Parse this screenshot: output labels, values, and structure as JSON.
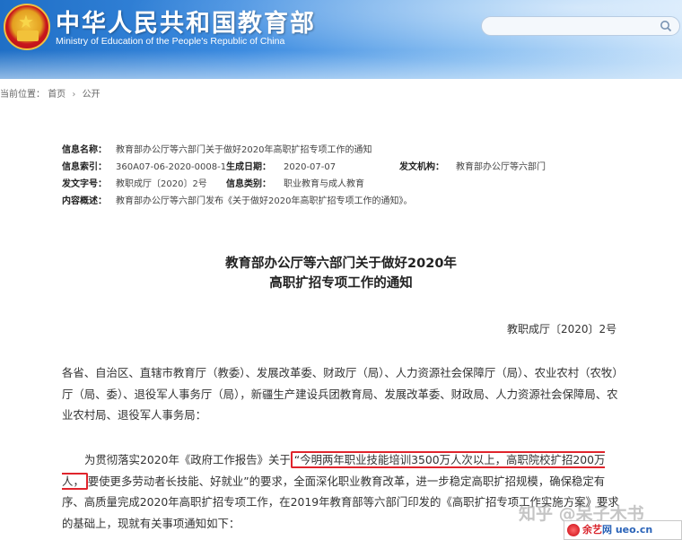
{
  "header": {
    "title": "中华人民共和国教育部",
    "subtitle": "Ministry of Education of the People's Republic of China",
    "search_placeholder": ""
  },
  "breadcrumb": {
    "prefix": "当前位置：",
    "items": [
      "首页",
      "公开"
    ],
    "separator": "›"
  },
  "info": {
    "rows": [
      [
        {
          "label": "信息名称：",
          "value": "教育部办公厅等六部门关于做好2020年高职扩招专项工作的通知"
        }
      ],
      [
        {
          "label": "信息索引：",
          "value": "360A07-06-2020-0008-1"
        },
        {
          "label": "生成日期：",
          "value": "2020-07-07"
        },
        {
          "label": "发文机构：",
          "value": "教育部办公厅等六部门"
        }
      ],
      [
        {
          "label": "发文字号：",
          "value": "教职成厅〔2020〕2号"
        },
        {
          "label": "信息类别：",
          "value": "职业教育与成人教育"
        }
      ],
      [
        {
          "label": "内容概述：",
          "value": "教育部办公厅等六部门发布《关于做好2020年高职扩招专项工作的通知》。"
        }
      ]
    ]
  },
  "document": {
    "title_line1": "教育部办公厅等六部门关于做好2020年",
    "title_line2": "高职扩招专项工作的通知",
    "number": "教职成厅〔2020〕2号",
    "paragraph1": "各省、自治区、直辖市教育厅（教委）、发展改革委、财政厅（局）、人力资源社会保障厅（局）、农业农村（农牧）厅（局、委）、退役军人事务厅（局），新疆生产建设兵团教育局、发展改革委、财政局、人力资源社会保障局、农业农村局、退役军人事务局：",
    "paragraph2_before": "为贯彻落实2020年《政府工作报告》关于",
    "paragraph2_highlight": "“今明两年职业技能培训3500万人次以上，高职院校扩招200万人，",
    "paragraph2_after": "要使更多劳动者长技能、好就业”的要求，全面深化职业教育改革，进一步稳定高职扩招规模，确保稳定有序、高质量完成2020年高职扩招专项工作，在2019年教育部等六部门印发的《高职扩招专项工作实施方案》要求的基础上，现就有关事项通知如下："
  },
  "watermark": {
    "text": "知乎 @呆子木书",
    "badge_brand": "余艺",
    "badge_domain": "网 ueo.cn"
  },
  "colors": {
    "header_blue": "#1f6fc6",
    "highlight_red": "#e0242c"
  }
}
